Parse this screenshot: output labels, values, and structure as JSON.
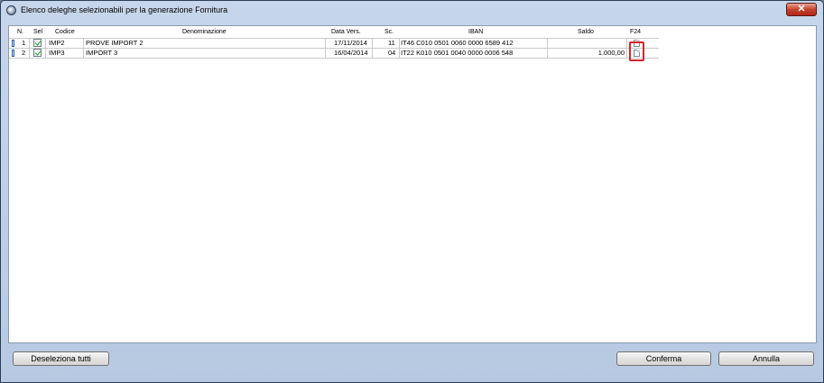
{
  "window": {
    "title": "Elenco deleghe selezionabili per la generazione Fornitura",
    "close_label": "✕"
  },
  "table": {
    "headers": {
      "n": "N.",
      "sel": "Sel",
      "codice": "Codice",
      "denominazione": "Denominazione",
      "data_vers": "Data Vers.",
      "sc": "Sc.",
      "iban": "IBAN",
      "saldo": "Saldo",
      "f24": "F24"
    },
    "rows": [
      {
        "n": "1",
        "sel": true,
        "codice": "IMP2",
        "denominazione": "PROVE IMPORT 2",
        "data_vers": "17/11/2014",
        "sc": "11",
        "iban": "IT46 C010 0501 0060 0000 6589 412",
        "saldo": "",
        "f24_icon": "document-icon"
      },
      {
        "n": "2",
        "sel": true,
        "codice": "IMP3",
        "denominazione": "IMPORT 3",
        "data_vers": "16/04/2014",
        "sc": "04",
        "iban": "IT22 K010 0501 0040 0000 0006 548",
        "saldo": "1.000,00",
        "f24_icon": "document-icon"
      }
    ]
  },
  "buttons": {
    "deselect_all": "Deseleziona tutti",
    "confirm": "Conferma",
    "cancel": "Annulla"
  },
  "colors": {
    "window_frame": "#b7c9e2",
    "highlight_border": "#d6262a",
    "check_color": "#1aa31a"
  }
}
